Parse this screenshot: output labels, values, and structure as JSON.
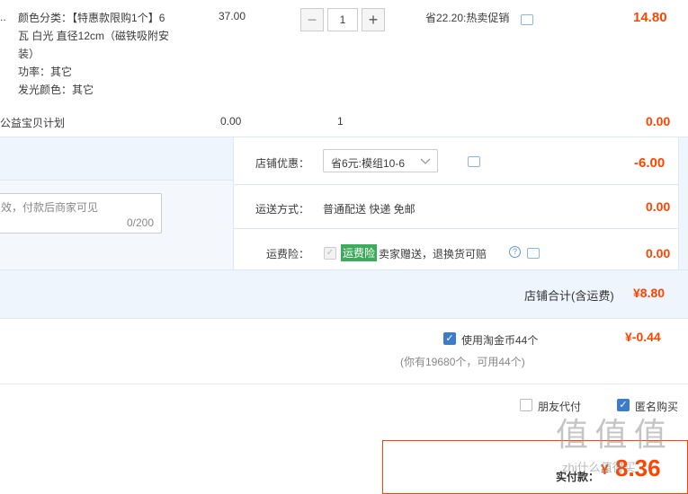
{
  "item": {
    "truncated_name": "..",
    "sku_label": "颜色分类：",
    "sku_value_line1": "【特惠款限购1个】6",
    "sku_value_line2": "瓦 白光 直径12cm（磁铁吸附安",
    "sku_value_line3": "装）",
    "power": "功率：其它",
    "color": "发光颜色：其它",
    "price": "37.00",
    "quantity": "1",
    "minus": "−",
    "plus": "+",
    "promo": "省22.20:热卖促销",
    "subtotal": "14.80"
  },
  "charity": {
    "name": "公益宝贝计划",
    "price": "0.00",
    "quantity": "1",
    "subtotal": "0.00"
  },
  "shop": {
    "discount_label": "店铺优惠：",
    "discount_select": "省6元:模组10-6",
    "discount_amount": "-6.00",
    "shipping_label": "运送方式：",
    "shipping_value": "普通配送 快递 免邮",
    "shipping_amount": "0.00",
    "insurance_label": "运费险：",
    "insurance_badge": "运费险",
    "insurance_text": "卖家赠送，退换货可赔",
    "insurance_amount": "0.00",
    "memo_placeholder": "效，付款后商家可见",
    "memo_counter": "0/200",
    "total_label": "店铺合计(含运费)",
    "total_value": "¥8.80"
  },
  "coins": {
    "label": "使用淘金币44个",
    "note": "(你有19680个，可用44个)",
    "amount": "¥-0.44"
  },
  "options": {
    "friend_pay": "朋友代付",
    "anonymous": "匿名购买"
  },
  "pay": {
    "label": "实付款：",
    "currency": "¥",
    "amount": "8.36"
  },
  "watermark": "值 值 值",
  "watermark_url": "zhi什么值得买"
}
